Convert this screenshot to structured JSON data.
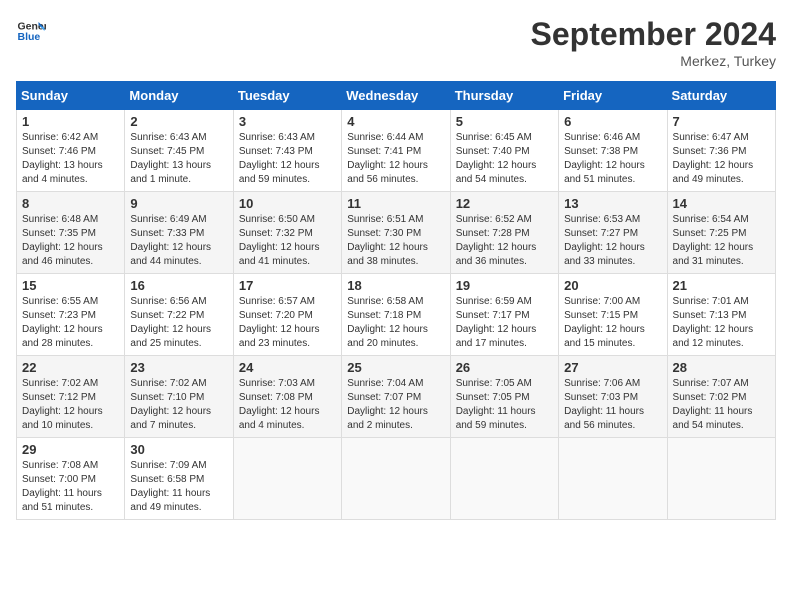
{
  "header": {
    "logo_line1": "General",
    "logo_line2": "Blue",
    "month": "September 2024",
    "location": "Merkez, Turkey"
  },
  "weekdays": [
    "Sunday",
    "Monday",
    "Tuesday",
    "Wednesday",
    "Thursday",
    "Friday",
    "Saturday"
  ],
  "weeks": [
    [
      {
        "day": "1",
        "info": "Sunrise: 6:42 AM\nSunset: 7:46 PM\nDaylight: 13 hours\nand 4 minutes."
      },
      {
        "day": "2",
        "info": "Sunrise: 6:43 AM\nSunset: 7:45 PM\nDaylight: 13 hours\nand 1 minute."
      },
      {
        "day": "3",
        "info": "Sunrise: 6:43 AM\nSunset: 7:43 PM\nDaylight: 12 hours\nand 59 minutes."
      },
      {
        "day": "4",
        "info": "Sunrise: 6:44 AM\nSunset: 7:41 PM\nDaylight: 12 hours\nand 56 minutes."
      },
      {
        "day": "5",
        "info": "Sunrise: 6:45 AM\nSunset: 7:40 PM\nDaylight: 12 hours\nand 54 minutes."
      },
      {
        "day": "6",
        "info": "Sunrise: 6:46 AM\nSunset: 7:38 PM\nDaylight: 12 hours\nand 51 minutes."
      },
      {
        "day": "7",
        "info": "Sunrise: 6:47 AM\nSunset: 7:36 PM\nDaylight: 12 hours\nand 49 minutes."
      }
    ],
    [
      {
        "day": "8",
        "info": "Sunrise: 6:48 AM\nSunset: 7:35 PM\nDaylight: 12 hours\nand 46 minutes."
      },
      {
        "day": "9",
        "info": "Sunrise: 6:49 AM\nSunset: 7:33 PM\nDaylight: 12 hours\nand 44 minutes."
      },
      {
        "day": "10",
        "info": "Sunrise: 6:50 AM\nSunset: 7:32 PM\nDaylight: 12 hours\nand 41 minutes."
      },
      {
        "day": "11",
        "info": "Sunrise: 6:51 AM\nSunset: 7:30 PM\nDaylight: 12 hours\nand 38 minutes."
      },
      {
        "day": "12",
        "info": "Sunrise: 6:52 AM\nSunset: 7:28 PM\nDaylight: 12 hours\nand 36 minutes."
      },
      {
        "day": "13",
        "info": "Sunrise: 6:53 AM\nSunset: 7:27 PM\nDaylight: 12 hours\nand 33 minutes."
      },
      {
        "day": "14",
        "info": "Sunrise: 6:54 AM\nSunset: 7:25 PM\nDaylight: 12 hours\nand 31 minutes."
      }
    ],
    [
      {
        "day": "15",
        "info": "Sunrise: 6:55 AM\nSunset: 7:23 PM\nDaylight: 12 hours\nand 28 minutes."
      },
      {
        "day": "16",
        "info": "Sunrise: 6:56 AM\nSunset: 7:22 PM\nDaylight: 12 hours\nand 25 minutes."
      },
      {
        "day": "17",
        "info": "Sunrise: 6:57 AM\nSunset: 7:20 PM\nDaylight: 12 hours\nand 23 minutes."
      },
      {
        "day": "18",
        "info": "Sunrise: 6:58 AM\nSunset: 7:18 PM\nDaylight: 12 hours\nand 20 minutes."
      },
      {
        "day": "19",
        "info": "Sunrise: 6:59 AM\nSunset: 7:17 PM\nDaylight: 12 hours\nand 17 minutes."
      },
      {
        "day": "20",
        "info": "Sunrise: 7:00 AM\nSunset: 7:15 PM\nDaylight: 12 hours\nand 15 minutes."
      },
      {
        "day": "21",
        "info": "Sunrise: 7:01 AM\nSunset: 7:13 PM\nDaylight: 12 hours\nand 12 minutes."
      }
    ],
    [
      {
        "day": "22",
        "info": "Sunrise: 7:02 AM\nSunset: 7:12 PM\nDaylight: 12 hours\nand 10 minutes."
      },
      {
        "day": "23",
        "info": "Sunrise: 7:02 AM\nSunset: 7:10 PM\nDaylight: 12 hours\nand 7 minutes."
      },
      {
        "day": "24",
        "info": "Sunrise: 7:03 AM\nSunset: 7:08 PM\nDaylight: 12 hours\nand 4 minutes."
      },
      {
        "day": "25",
        "info": "Sunrise: 7:04 AM\nSunset: 7:07 PM\nDaylight: 12 hours\nand 2 minutes."
      },
      {
        "day": "26",
        "info": "Sunrise: 7:05 AM\nSunset: 7:05 PM\nDaylight: 11 hours\nand 59 minutes."
      },
      {
        "day": "27",
        "info": "Sunrise: 7:06 AM\nSunset: 7:03 PM\nDaylight: 11 hours\nand 56 minutes."
      },
      {
        "day": "28",
        "info": "Sunrise: 7:07 AM\nSunset: 7:02 PM\nDaylight: 11 hours\nand 54 minutes."
      }
    ],
    [
      {
        "day": "29",
        "info": "Sunrise: 7:08 AM\nSunset: 7:00 PM\nDaylight: 11 hours\nand 51 minutes."
      },
      {
        "day": "30",
        "info": "Sunrise: 7:09 AM\nSunset: 6:58 PM\nDaylight: 11 hours\nand 49 minutes."
      },
      {
        "day": "",
        "info": ""
      },
      {
        "day": "",
        "info": ""
      },
      {
        "day": "",
        "info": ""
      },
      {
        "day": "",
        "info": ""
      },
      {
        "day": "",
        "info": ""
      }
    ]
  ]
}
